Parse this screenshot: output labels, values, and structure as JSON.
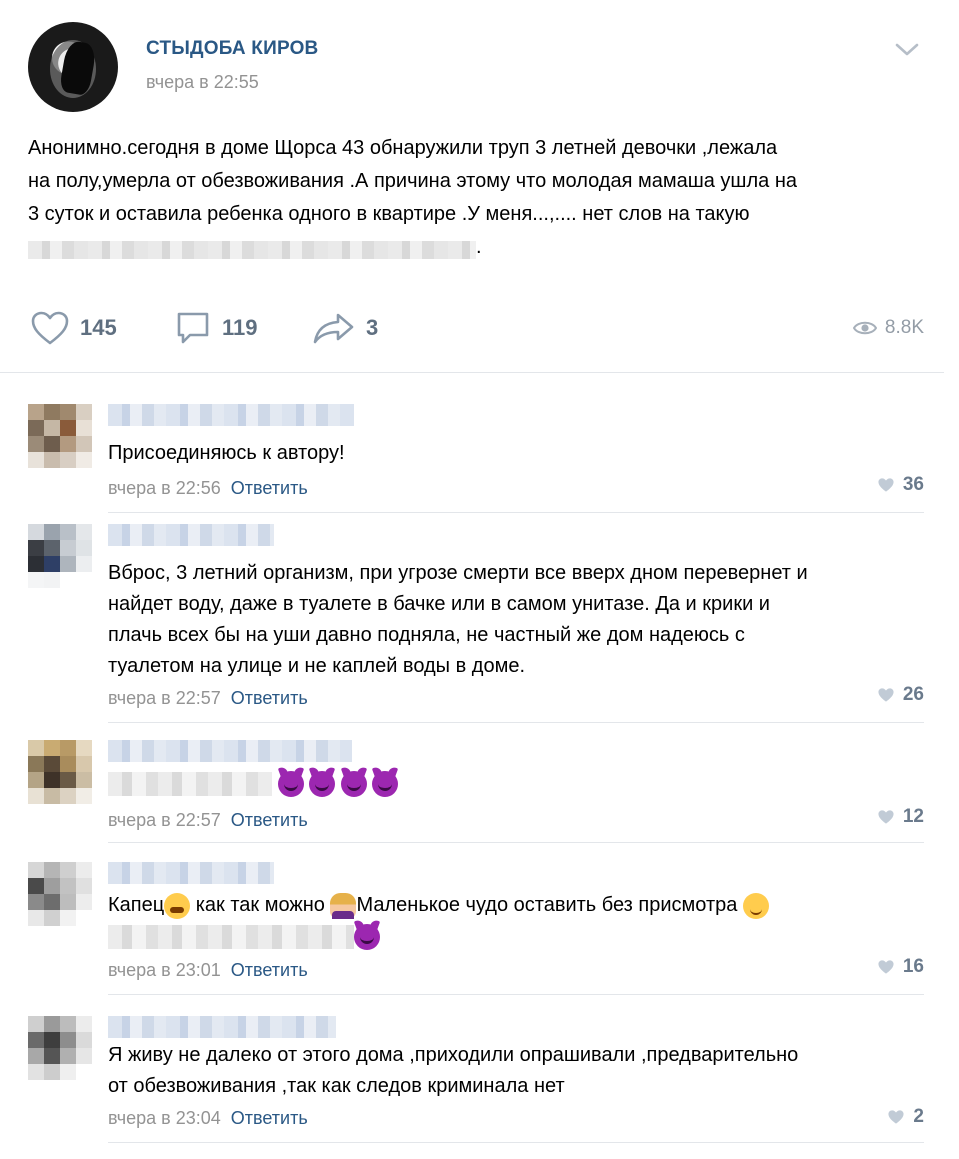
{
  "post": {
    "author": "СТЫДОБА КИРОВ",
    "time": "вчера в 22:55",
    "text_line1": "Анонимно.сегодня в доме Щорса 43 обнаружили труп 3 летней девочки ,лежала",
    "text_line2": "на полу,умерла от обезвоживания .А причина этому что молодая мамаша ушла на",
    "text_line3": "3 суток и оставила ребенка одного в квартире .У меня...,.... нет слов на такую",
    "text_line4_end": ".",
    "likes": "145",
    "comments": "119",
    "shares": "3",
    "views": "8.8K"
  },
  "icons": {
    "menu": "chevron-down-icon",
    "like": "heart-icon",
    "comment": "comment-bubble-icon",
    "share": "share-arrow-icon",
    "views": "eye-icon"
  },
  "colors": {
    "link": "#2a5885",
    "meta": "#939393",
    "action": "#5f6f80"
  },
  "comments": [
    {
      "lines": [
        "Присоединяюсь к автору!"
      ],
      "time": "вчера в 22:56",
      "reply": "Ответить",
      "likes": "36"
    },
    {
      "lines": [
        "Вброс, 3 летний организм, при угрозе смерти все вверх дном перевернет и",
        "найдет воду, даже в туалете в бачке или в самом унитазе. Да и крики и",
        "плачь всех бы на уши давно подняла, не частный же дом надеюсь с",
        "туалетом на улице и не каплей воды в доме."
      ],
      "time": "вчера в 22:57",
      "reply": "Ответить",
      "likes": "26"
    },
    {
      "lines": [],
      "time": "вчера в 22:57",
      "reply": "Ответить",
      "likes": "12"
    },
    {
      "line1_a": "Капец",
      "line1_b": " как так можно ",
      "line1_c": "Маленькое чудо оставить без присмотра ",
      "time": "вчера в 23:01",
      "reply": "Ответить",
      "likes": "16"
    },
    {
      "lines": [
        "Я живу не далеко от этого дома ,приходили опрашивали ,предварительно",
        "от обезвоживания ,так как следов криминала нет"
      ],
      "time": "вчера в 23:04",
      "reply": "Ответить",
      "likes": "2"
    }
  ]
}
